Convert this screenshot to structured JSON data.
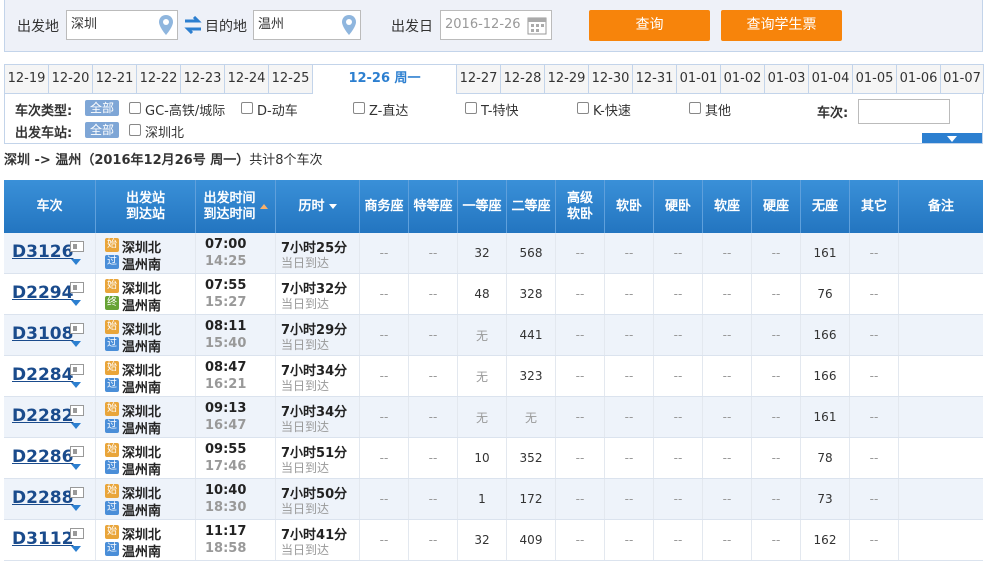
{
  "search": {
    "from_label": "出发地",
    "from_value": "深圳",
    "to_label": "目的地",
    "to_value": "温州",
    "date_label": "出发日",
    "date_value": "2016-12-26",
    "query_button": "查询",
    "student_button": "查询学生票"
  },
  "date_tabs": [
    "12-19",
    "12-20",
    "12-21",
    "12-22",
    "12-23",
    "12-24",
    "12-25",
    "12-26 周一",
    "12-27",
    "12-28",
    "12-29",
    "12-30",
    "12-31",
    "01-01",
    "01-02",
    "01-03",
    "01-04",
    "01-05",
    "01-06",
    "01-07"
  ],
  "filters": {
    "type_label": "车次类型:",
    "all": "全部",
    "types": [
      "GC-高铁/城际",
      "D-动车",
      "Z-直达",
      "T-特快",
      "K-快速",
      "其他"
    ],
    "station_label": "出发车站:",
    "stations": [
      "深圳北"
    ],
    "train_no_label": "车次:"
  },
  "summary": {
    "route": "深圳 -> 温州（2016年12月26号 周一）",
    "count": "共计8个车次"
  },
  "table": {
    "headers": {
      "train": "车次",
      "stn1": "出发站",
      "stn2": "到达站",
      "time1": "出发时间",
      "time2": "到达时间",
      "duration": "历时",
      "business": "商务座",
      "special": "特等座",
      "first": "一等座",
      "second": "二等座",
      "hsl1": "高级",
      "hsl2": "软卧",
      "soft_sleeper": "软卧",
      "hard_sleeper": "硬卧",
      "soft_seat": "软座",
      "hard_seat": "硬座",
      "no_seat": "无座",
      "other": "其它",
      "remark": "备注"
    },
    "rows": [
      {
        "no": "D3126",
        "from": "深圳北",
        "to": "温州南",
        "from_badge": "始",
        "to_badge": "过",
        "dep": "07:00",
        "arr": "14:25",
        "dur": "7小时25分",
        "day": "当日到达",
        "seats": [
          "--",
          "--",
          "32",
          "568",
          "--",
          "--",
          "--",
          "--",
          "--",
          "161",
          "--"
        ]
      },
      {
        "no": "D2294",
        "from": "深圳北",
        "to": "温州南",
        "from_badge": "始",
        "to_badge": "终",
        "dep": "07:55",
        "arr": "15:27",
        "dur": "7小时32分",
        "day": "当日到达",
        "seats": [
          "--",
          "--",
          "48",
          "328",
          "--",
          "--",
          "--",
          "--",
          "--",
          "76",
          "--"
        ]
      },
      {
        "no": "D3108",
        "from": "深圳北",
        "to": "温州南",
        "from_badge": "始",
        "to_badge": "过",
        "dep": "08:11",
        "arr": "15:40",
        "dur": "7小时29分",
        "day": "当日到达",
        "seats": [
          "--",
          "--",
          "无",
          "441",
          "--",
          "--",
          "--",
          "--",
          "--",
          "166",
          "--"
        ]
      },
      {
        "no": "D2284",
        "from": "深圳北",
        "to": "温州南",
        "from_badge": "始",
        "to_badge": "过",
        "dep": "08:47",
        "arr": "16:21",
        "dur": "7小时34分",
        "day": "当日到达",
        "seats": [
          "--",
          "--",
          "无",
          "323",
          "--",
          "--",
          "--",
          "--",
          "--",
          "166",
          "--"
        ]
      },
      {
        "no": "D2282",
        "from": "深圳北",
        "to": "温州南",
        "from_badge": "始",
        "to_badge": "过",
        "dep": "09:13",
        "arr": "16:47",
        "dur": "7小时34分",
        "day": "当日到达",
        "seats": [
          "--",
          "--",
          "无",
          "无",
          "--",
          "--",
          "--",
          "--",
          "--",
          "161",
          "--"
        ]
      },
      {
        "no": "D2286",
        "from": "深圳北",
        "to": "温州南",
        "from_badge": "始",
        "to_badge": "过",
        "dep": "09:55",
        "arr": "17:46",
        "dur": "7小时51分",
        "day": "当日到达",
        "seats": [
          "--",
          "--",
          "10",
          "352",
          "--",
          "--",
          "--",
          "--",
          "--",
          "78",
          "--"
        ]
      },
      {
        "no": "D2288",
        "from": "深圳北",
        "to": "温州南",
        "from_badge": "始",
        "to_badge": "过",
        "dep": "10:40",
        "arr": "18:30",
        "dur": "7小时50分",
        "day": "当日到达",
        "seats": [
          "--",
          "--",
          "1",
          "172",
          "--",
          "--",
          "--",
          "--",
          "--",
          "73",
          "--"
        ]
      },
      {
        "no": "D3112",
        "from": "深圳北",
        "to": "温州南",
        "from_badge": "始",
        "to_badge": "过",
        "dep": "11:17",
        "arr": "18:58",
        "dur": "7小时41分",
        "day": "当日到达",
        "seats": [
          "--",
          "--",
          "32",
          "409",
          "--",
          "--",
          "--",
          "--",
          "--",
          "162",
          "--"
        ]
      }
    ]
  }
}
